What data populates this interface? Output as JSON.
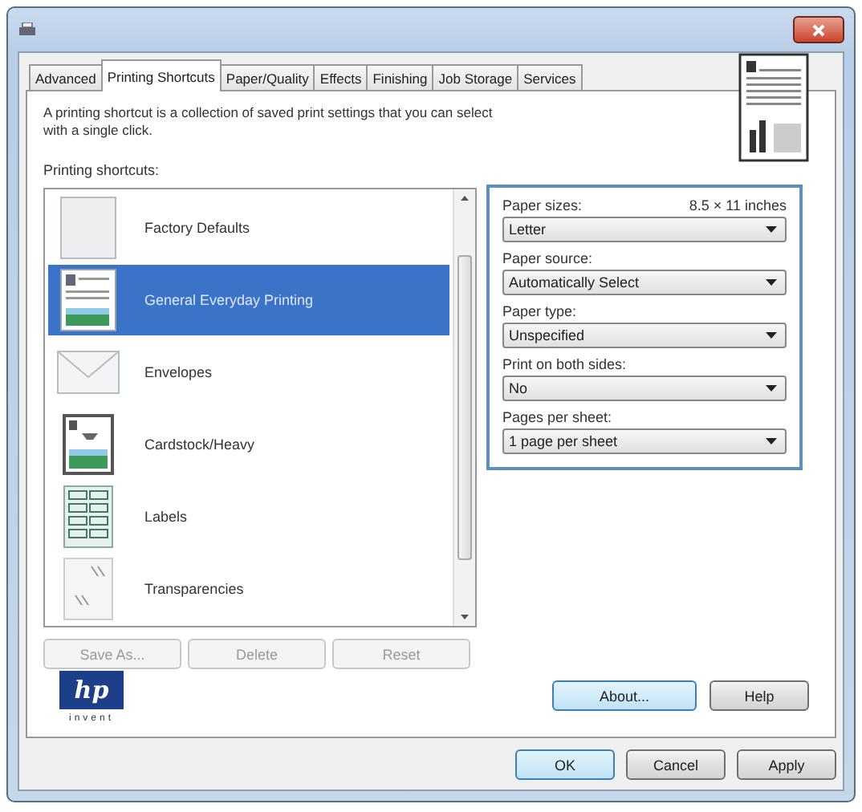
{
  "window": {
    "title_icon": true
  },
  "tabs": [
    {
      "label": "Advanced",
      "selected": false
    },
    {
      "label": "Printing Shortcuts",
      "selected": true
    },
    {
      "label": "Paper/Quality",
      "selected": false
    },
    {
      "label": "Effects",
      "selected": false
    },
    {
      "label": "Finishing",
      "selected": false
    },
    {
      "label": "Job Storage",
      "selected": false
    },
    {
      "label": "Services",
      "selected": false
    }
  ],
  "description": "A printing shortcut is a collection of saved print settings that you can select with a single click.",
  "shortcuts": {
    "label": "Printing shortcuts:",
    "items": [
      {
        "name": "Factory Defaults",
        "kind": "blank",
        "selected": false
      },
      {
        "name": "General Everyday Printing",
        "kind": "document",
        "selected": true
      },
      {
        "name": "Envelopes",
        "kind": "envelope",
        "selected": false
      },
      {
        "name": "Cardstock/Heavy",
        "kind": "cardstock",
        "selected": false
      },
      {
        "name": "Labels",
        "kind": "labels",
        "selected": false
      },
      {
        "name": "Transparencies",
        "kind": "transparency",
        "selected": false
      }
    ]
  },
  "list_buttons": [
    {
      "label": "Save As...",
      "disabled": true
    },
    {
      "label": "Delete",
      "disabled": true
    },
    {
      "label": "Reset",
      "disabled": true
    }
  ],
  "settings": [
    {
      "label": "Paper sizes:",
      "note": "8.5 × 11 inches",
      "value": "Letter"
    },
    {
      "label": "Paper source:",
      "value": "Automatically Select"
    },
    {
      "label": "Paper type:",
      "value": "Unspecified"
    },
    {
      "label": "Print on both sides:",
      "value": "No"
    },
    {
      "label": "Pages per sheet:",
      "value": "1 page per sheet"
    }
  ],
  "logo": {
    "mark": "hp",
    "tagline": "invent"
  },
  "panel_buttons": [
    {
      "label": "About...",
      "focused": true
    },
    {
      "label": "Help",
      "focused": false
    }
  ],
  "dialog_buttons": [
    {
      "label": "OK",
      "focused": true
    },
    {
      "label": "Cancel",
      "focused": false
    },
    {
      "label": "Apply",
      "focused": false
    }
  ]
}
